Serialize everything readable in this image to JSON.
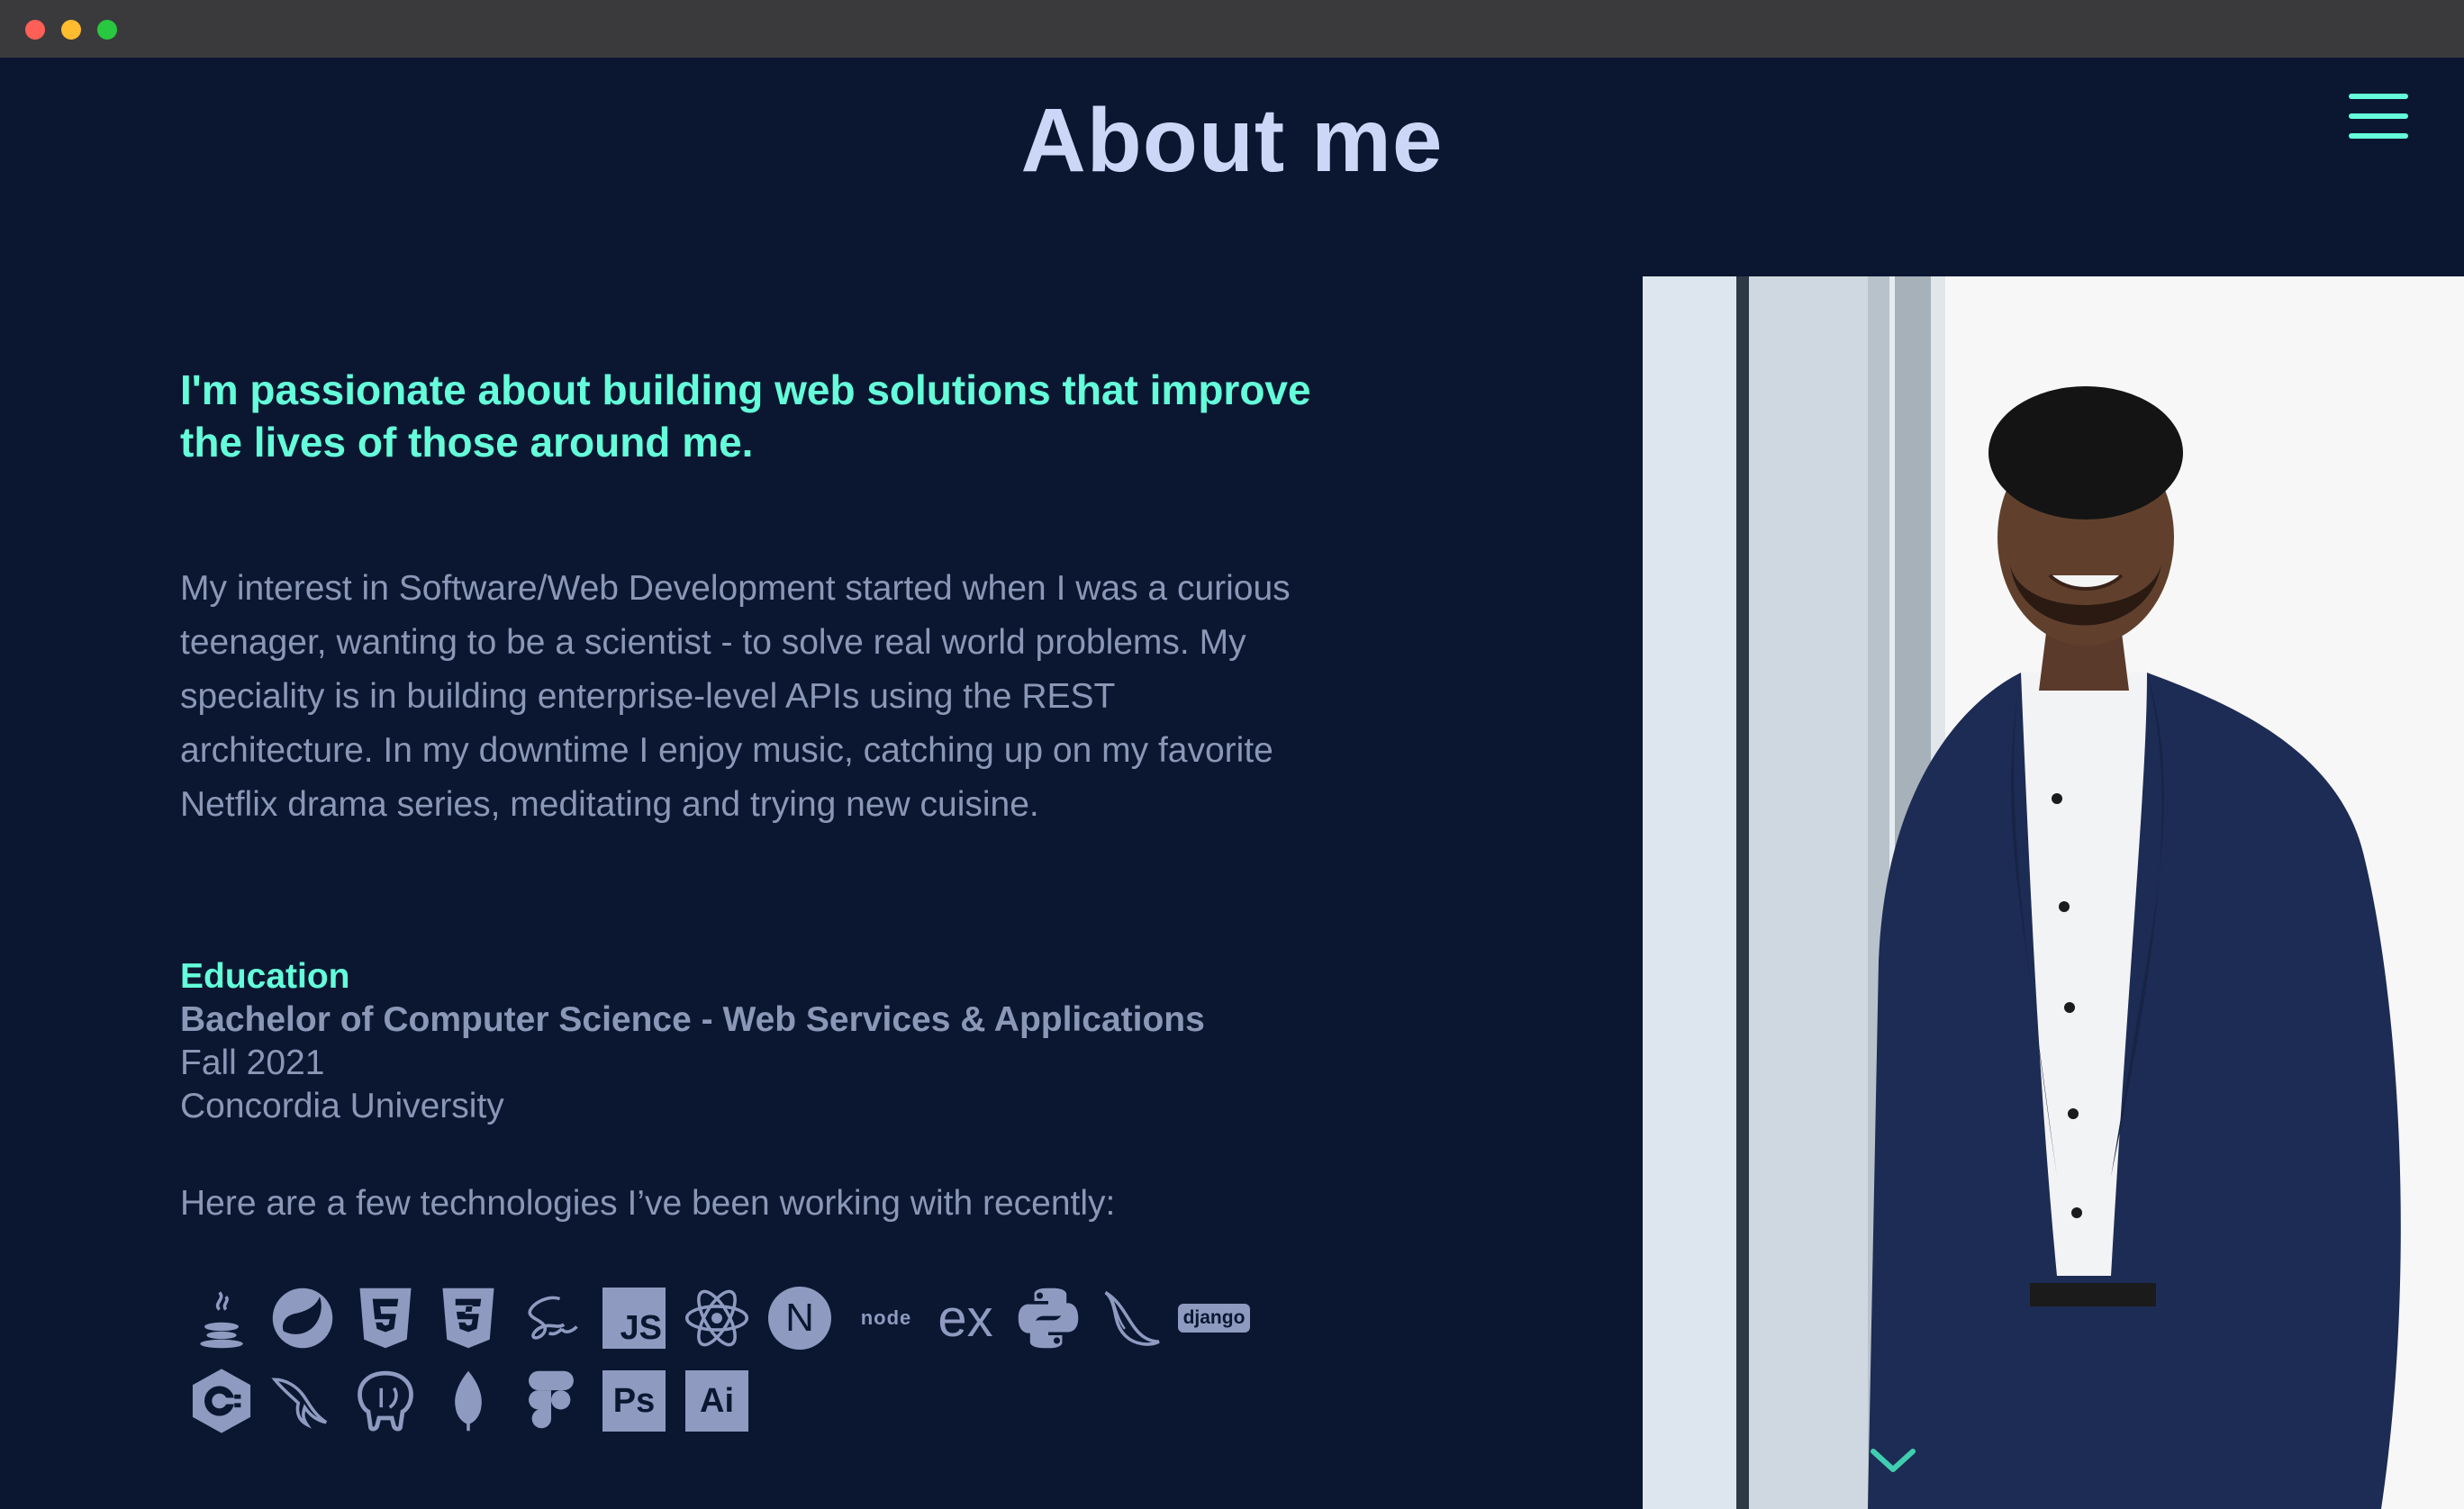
{
  "page": {
    "title": "About me",
    "menu_icon": "hamburger-menu-icon"
  },
  "about": {
    "tagline": "I'm passionate about building web solutions that improve the lives of those around me.",
    "bio": "My interest in Software/Web Development started when I was a curious teenager, wanting to be a scientist - to solve real world problems. My speciality is in building enterprise-level APIs using the REST architecture. In my downtime I enjoy music, catching up on my favorite Netflix drama series, meditating and trying new cuisine."
  },
  "education": {
    "heading": "Education",
    "degree": "Bachelor of Computer Science - Web Services & Applications",
    "term": "Fall 2021",
    "school": "Concordia University"
  },
  "technologies": {
    "intro": "Here are a few technologies I’ve been working with recently:",
    "js_label": "JS",
    "n_label": "N",
    "node_label": "node",
    "ex_label": "ex",
    "django_label": "django",
    "ps_label": "Ps",
    "ai_label": "Ai",
    "icons": [
      "java-icon",
      "spring-icon",
      "html5-icon",
      "css3-icon",
      "sass-icon",
      "javascript-icon",
      "react-icon",
      "nextjs-icon",
      "nodejs-icon",
      "express-icon",
      "python-icon",
      "flask-icon",
      "django-icon",
      "csharp-icon",
      "mysql-icon",
      "postgresql-icon",
      "mongodb-icon",
      "figma-icon",
      "photoshop-icon",
      "illustrator-icon"
    ]
  },
  "colors": {
    "background": "#0b1731",
    "accent": "#64ffda",
    "heading": "#ccd6f6",
    "body_text": "#8b97b6",
    "icon": "#8f9ac0"
  },
  "photo": {
    "alt": "portrait-photo"
  },
  "scroll_icon": "chevron-down-icon"
}
